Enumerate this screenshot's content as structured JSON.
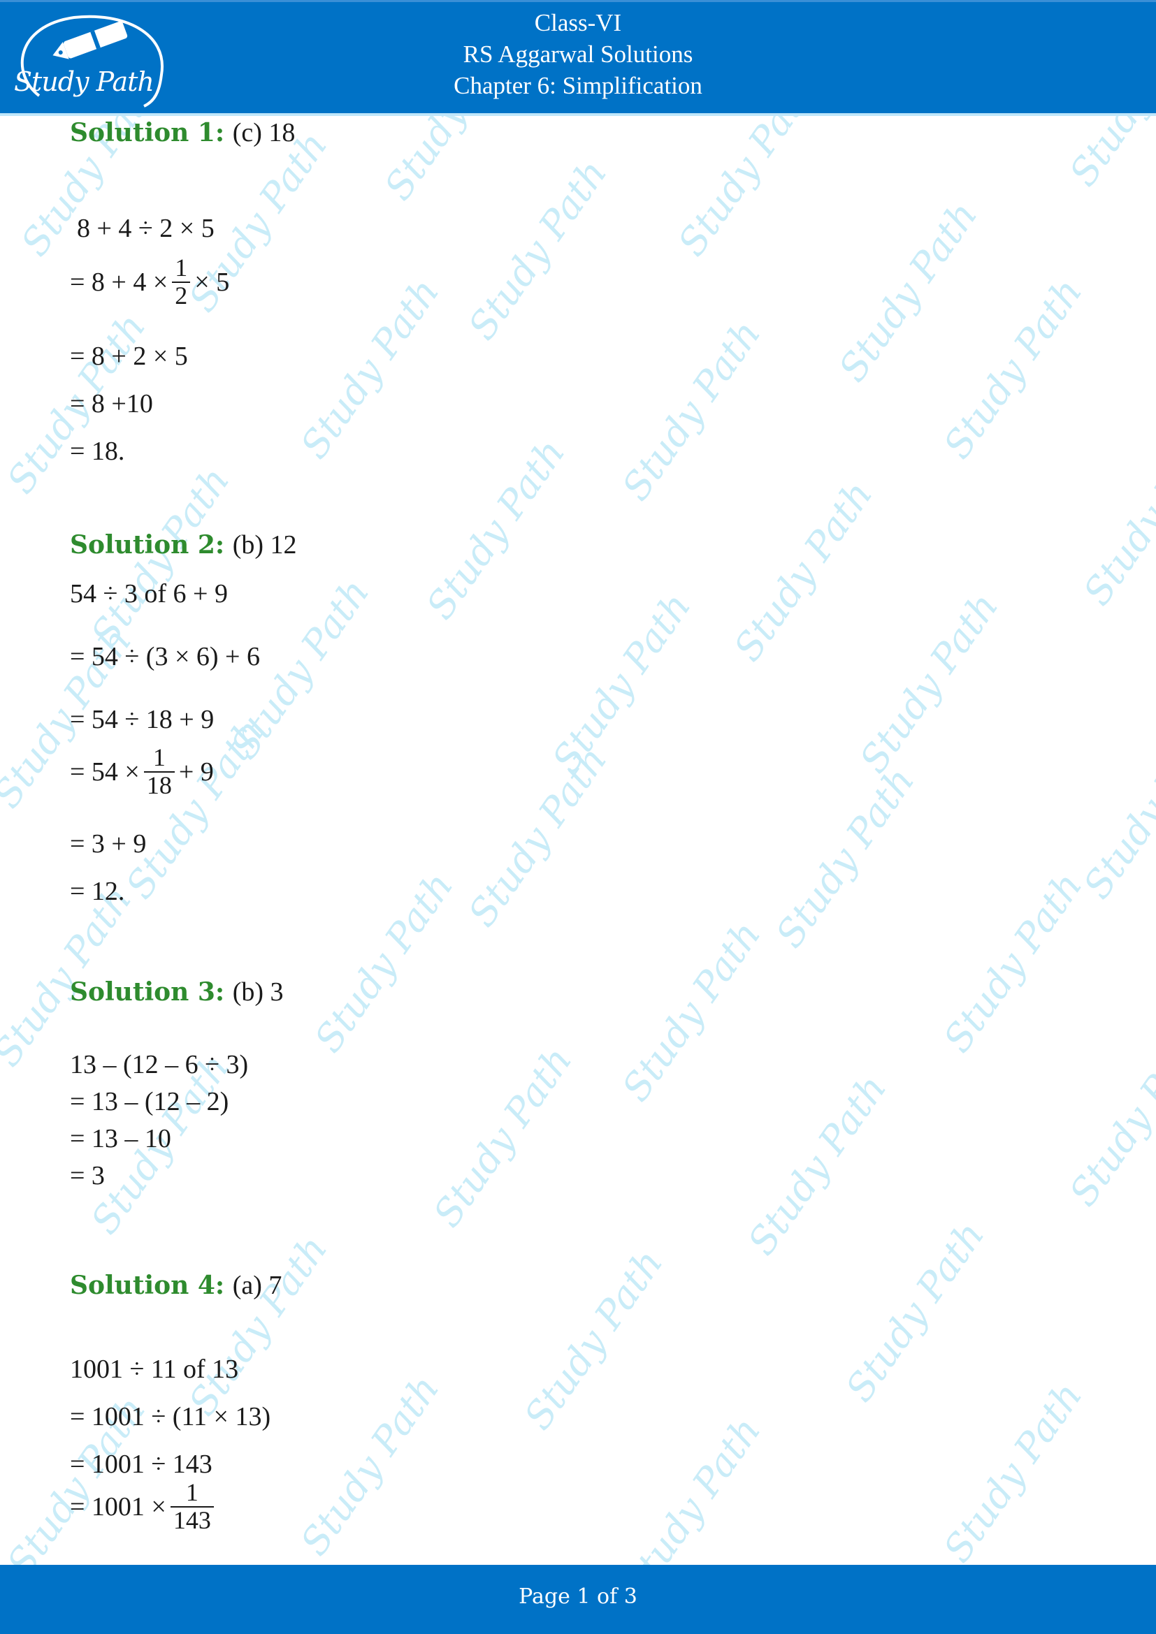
{
  "header": {
    "line1": "Class-VI",
    "line2": "RS Aggarwal Solutions",
    "line3": "Chapter 6: Simplification",
    "logo_text": "Study Path",
    "background_color": "#0072c6"
  },
  "watermark_text": "Study Path",
  "solutions": [
    {
      "label": "Solution 1:",
      "answer": "(c) 18",
      "steps": [
        {
          "text": "8 + 4 ÷ 2 × 5"
        },
        {
          "pre": "= 8 + 4 ×",
          "num": "1",
          "den": "2",
          "post": "× 5"
        },
        {
          "text": "= 8 + 2 × 5"
        },
        {
          "text": "= 8 +10"
        },
        {
          "text": "= 18."
        }
      ]
    },
    {
      "label": "Solution 2:",
      "answer": "(b) 12",
      "steps": [
        {
          "text": "54 ÷ 3 of 6 + 9"
        },
        {
          "text": "= 54 ÷ (3 × 6) + 6"
        },
        {
          "text": "= 54 ÷ 18 + 9"
        },
        {
          "pre": "= 54 ×",
          "num": "1",
          "den": "18",
          "post": "+ 9"
        },
        {
          "text": "= 3 + 9"
        },
        {
          "text": "= 12."
        }
      ]
    },
    {
      "label": "Solution 3:",
      "answer": "(b) 3",
      "steps": [
        {
          "text": "13 – (12 – 6 ÷ 3)"
        },
        {
          "text": "= 13 – (12 – 2)"
        },
        {
          "text": "= 13 – 10"
        },
        {
          "text": "= 3"
        }
      ]
    },
    {
      "label": "Solution 4:",
      "answer": "(a) 7",
      "steps": [
        {
          "text": "1001 ÷ 11 of 13"
        },
        {
          "text": "= 1001 ÷ (11 × 13)"
        },
        {
          "text": "= 1001 ÷ 143"
        },
        {
          "pre": "=  1001 ×",
          "num": "1",
          "den": "143",
          "post": ""
        }
      ]
    }
  ],
  "footer": {
    "page_label": "Page 1 of 3",
    "current_page": 1,
    "total_pages": 3
  },
  "colors": {
    "brand_blue": "#0072c6",
    "solution_label_green": "#2e8b2e",
    "watermark": "#c9ecf8"
  }
}
